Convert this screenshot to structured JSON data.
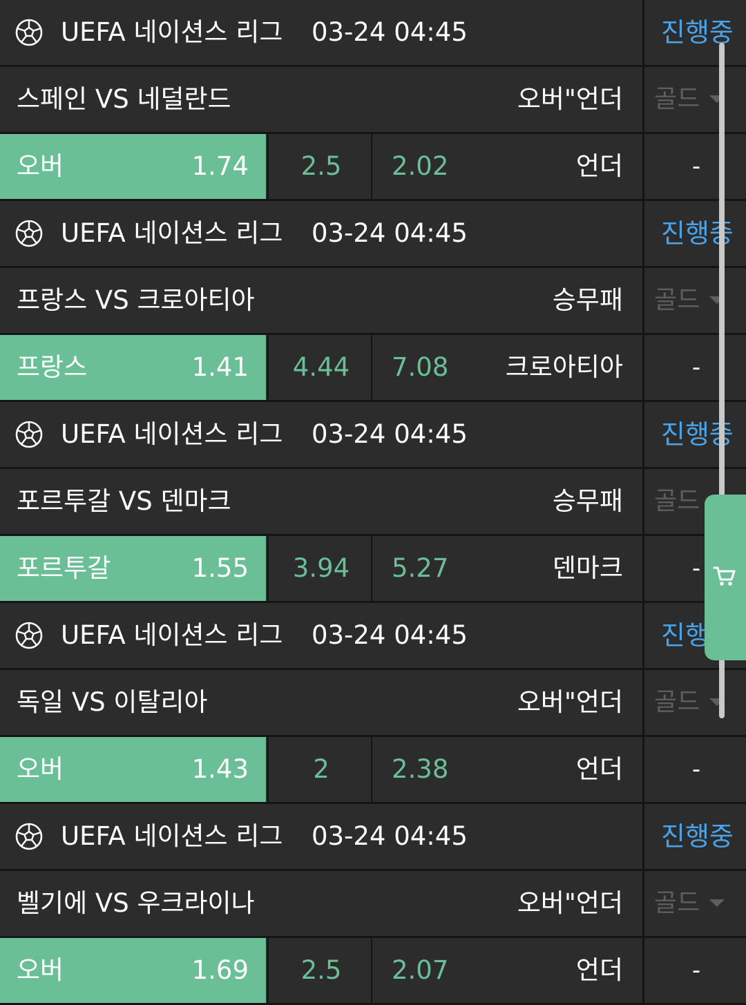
{
  "matches": [
    {
      "league": "UEFA 네이션스 리그",
      "datetime": "03-24 04:45",
      "status": "진행중",
      "teams": "스페인 VS 네덜란드",
      "market": "오버\"언더",
      "grade": "골드",
      "home_label": "오버",
      "home_odds": "1.74",
      "middle": "2.5",
      "away_odds": "2.02",
      "away_label": "언더",
      "side_value": "-"
    },
    {
      "league": "UEFA 네이션스 리그",
      "datetime": "03-24 04:45",
      "status": "진행중",
      "teams": "프랑스 VS 크로아티아",
      "market": "승무패",
      "grade": "골드",
      "home_label": "프랑스",
      "home_odds": "1.41",
      "middle": "4.44",
      "away_odds": "7.08",
      "away_label": "크로아티아",
      "side_value": "-"
    },
    {
      "league": "UEFA 네이션스 리그",
      "datetime": "03-24 04:45",
      "status": "진행중",
      "teams": "포르투갈 VS 덴마크",
      "market": "승무패",
      "grade": "골드",
      "home_label": "포르투갈",
      "home_odds": "1.55",
      "middle": "3.94",
      "away_odds": "5.27",
      "away_label": "덴마크",
      "side_value": "-"
    },
    {
      "league": "UEFA 네이션스 리그",
      "datetime": "03-24 04:45",
      "status": "진행중",
      "teams": "독일 VS 이탈리아",
      "market": "오버\"언더",
      "grade": "골드",
      "home_label": "오버",
      "home_odds": "1.43",
      "middle": "2",
      "away_odds": "2.38",
      "away_label": "언더",
      "side_value": "-"
    },
    {
      "league": "UEFA 네이션스 리그",
      "datetime": "03-24 04:45",
      "status": "진행중",
      "teams": "벨기에 VS 우크라이나",
      "market": "오버\"언더",
      "grade": "골드",
      "home_label": "오버",
      "home_odds": "1.69",
      "middle": "2.5",
      "away_odds": "2.07",
      "away_label": "언더",
      "side_value": "-"
    }
  ],
  "icons": {
    "sport": "soccer-ball-icon",
    "grade_caret": "caret-down-icon",
    "cart": "cart-icon"
  },
  "colors": {
    "accent_green": "#6abf96",
    "status_blue": "#4aa3e8",
    "row_bg": "#2c2c2c",
    "muted": "#5e5e5e"
  }
}
